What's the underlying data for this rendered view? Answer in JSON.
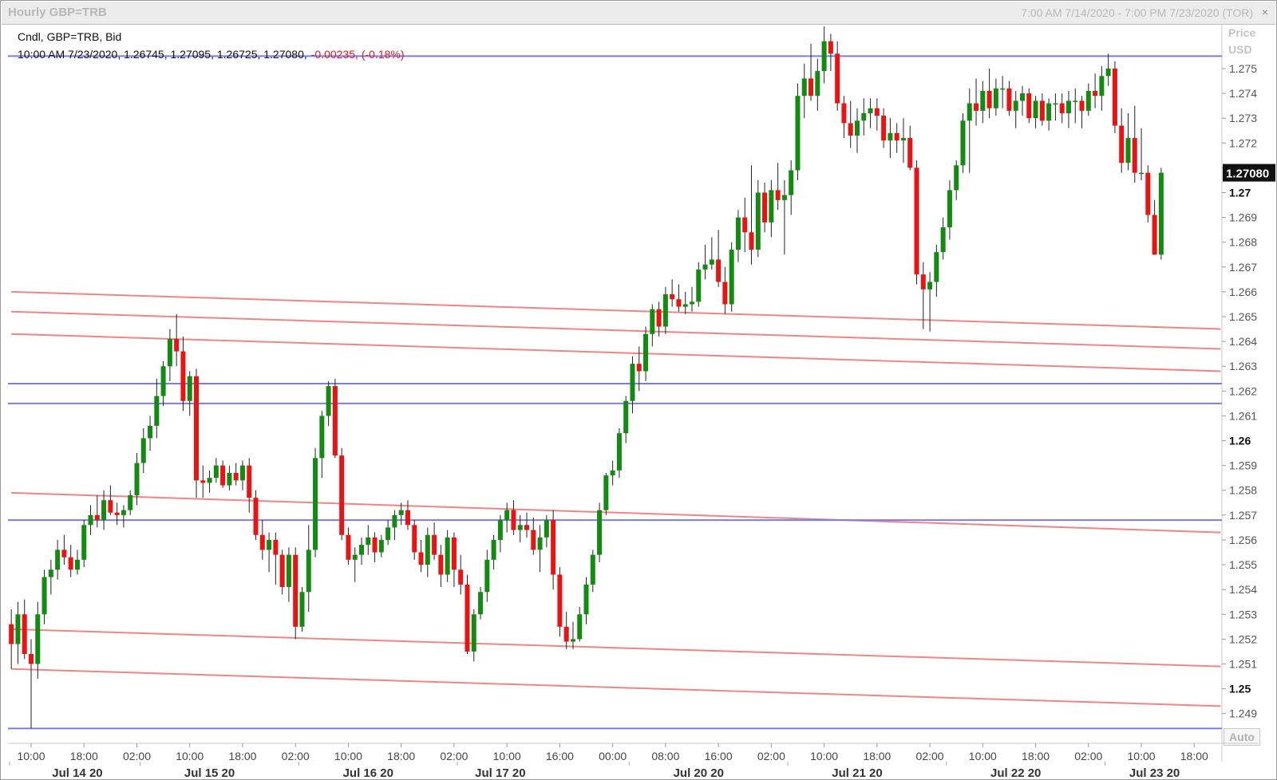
{
  "header": {
    "title": "Hourly GBP=TRB",
    "range": "7:00 AM 7/14/2020 - 7:00 PM 7/23/2020 (TOR)"
  },
  "legend": {
    "line1": "Cndl, GBP=TRB, Bid",
    "line2_prefix": "10:00 AM 7/23/2020, 1.26745, 1.27095, 1.26725, 1.27080,",
    "change": "-0.00235, (-0.18%)"
  },
  "axis": {
    "price_label": "Price",
    "unit_label": "USD",
    "auto_label": "Auto",
    "current_price": "1.27080",
    "up_color": "#118c11",
    "down_color": "#ee1111",
    "hline_color": "#7b7bf0",
    "trend_color": "#f07878"
  },
  "chart_data": {
    "type": "candlestick",
    "title": "Hourly GBP=TRB",
    "series_name": "GBP=TRB",
    "ylim": [
      1.2478,
      1.2768
    ],
    "y_ticks": [
      1.249,
      1.25,
      1.251,
      1.252,
      1.253,
      1.254,
      1.255,
      1.256,
      1.257,
      1.258,
      1.259,
      1.26,
      1.261,
      1.262,
      1.263,
      1.264,
      1.265,
      1.266,
      1.267,
      1.268,
      1.269,
      1.27,
      1.271,
      1.272,
      1.273,
      1.274,
      1.275
    ],
    "y_tick_labels": [
      "1.249",
      "1.25",
      "1.251",
      "1.252",
      "1.253",
      "1.254",
      "1.255",
      "1.256",
      "1.257",
      "1.258",
      "1.259",
      "1.26",
      "1.261",
      "1.262",
      "1.263",
      "1.264",
      "1.265",
      "1.266",
      "1.267",
      "1.268",
      "1.269",
      "1.27",
      "1.271",
      "1.272",
      "1.273",
      "1.274",
      "1.275"
    ],
    "x_tick_labels": [
      "10:00",
      "18:00",
      "02:00",
      "10:00",
      "18:00",
      "02:00",
      "10:00",
      "18:00",
      "02:00",
      "10:00",
      "16:00",
      "00:00",
      "08:00",
      "16:00",
      "02:00",
      "10:00",
      "18:00",
      "02:00",
      "10:00",
      "18:00",
      "02:00",
      "10:00",
      "18:00"
    ],
    "x_tick_index": [
      0,
      8,
      16,
      24,
      32,
      40,
      48,
      56,
      64,
      72,
      80,
      88,
      96,
      104,
      112,
      120,
      128,
      136,
      144,
      152,
      160,
      168,
      176
    ],
    "day_labels": [
      "Jul 14 20",
      "Jul 15 20",
      "Jul 16 20",
      "Jul 17 20",
      "Jul 20 20",
      "Jul 21 20",
      "Jul 22 20",
      "Jul 23 20"
    ],
    "day_label_index": [
      7,
      27,
      51,
      71,
      101,
      125,
      149,
      170
    ],
    "day_separator_index": [
      -3.5,
      16.5,
      40.5,
      64.5,
      90.5,
      114.5,
      138.5,
      162.5
    ],
    "horizontal_levels": [
      1.2755,
      1.2623,
      1.2615,
      1.2568,
      1.2484
    ],
    "trend_lines": [
      {
        "from": [
          -3,
          1.266
        ],
        "to": [
          180,
          1.2645
        ]
      },
      {
        "from": [
          -3,
          1.2652
        ],
        "to": [
          180,
          1.2637
        ]
      },
      {
        "from": [
          -3,
          1.2643
        ],
        "to": [
          180,
          1.2628
        ]
      },
      {
        "from": [
          -3,
          1.2579
        ],
        "to": [
          180,
          1.2563
        ]
      },
      {
        "from": [
          -3,
          1.2524
        ],
        "to": [
          180,
          1.2509
        ]
      },
      {
        "from": [
          -3,
          1.2508
        ],
        "to": [
          180,
          1.2493
        ]
      }
    ],
    "candles": [
      [
        -3,
        1.2526,
        1.2532,
        1.2508,
        1.2518
      ],
      [
        -2,
        1.2518,
        1.2535,
        1.251,
        1.253
      ],
      [
        -1,
        1.253,
        1.2536,
        1.2512,
        1.2514
      ],
      [
        0,
        1.2514,
        1.252,
        1.2484,
        1.251
      ],
      [
        1,
        1.251,
        1.2535,
        1.2504,
        1.253
      ],
      [
        2,
        1.253,
        1.2548,
        1.2526,
        1.2545
      ],
      [
        3,
        1.2545,
        1.2552,
        1.2538,
        1.2548
      ],
      [
        4,
        1.2548,
        1.256,
        1.2544,
        1.2556
      ],
      [
        5,
        1.2556,
        1.2562,
        1.255,
        1.2553
      ],
      [
        6,
        1.2553,
        1.2558,
        1.2545,
        1.2548
      ],
      [
        7,
        1.2548,
        1.2556,
        1.2546,
        1.2552
      ],
      [
        8,
        1.2552,
        1.2568,
        1.2549,
        1.2566
      ],
      [
        9,
        1.2566,
        1.2574,
        1.2562,
        1.257
      ],
      [
        10,
        1.257,
        1.2578,
        1.2565,
        1.2568
      ],
      [
        11,
        1.2568,
        1.258,
        1.2564,
        1.2576
      ],
      [
        12,
        1.2576,
        1.2582,
        1.257,
        1.2571
      ],
      [
        13,
        1.2571,
        1.2575,
        1.2566,
        1.257
      ],
      [
        14,
        1.257,
        1.2574,
        1.2565,
        1.2572
      ],
      [
        15,
        1.2572,
        1.258,
        1.257,
        1.2578
      ],
      [
        16,
        1.2578,
        1.2595,
        1.2574,
        1.2591
      ],
      [
        17,
        1.2591,
        1.2605,
        1.2587,
        1.2601
      ],
      [
        18,
        1.2601,
        1.261,
        1.2596,
        1.2606
      ],
      [
        19,
        1.2606,
        1.2625,
        1.2601,
        1.2618
      ],
      [
        20,
        1.2618,
        1.2632,
        1.2614,
        1.263
      ],
      [
        21,
        1.263,
        1.2645,
        1.2624,
        1.2641
      ],
      [
        22,
        1.2641,
        1.2651,
        1.263,
        1.2636
      ],
      [
        23,
        1.2636,
        1.2642,
        1.2612,
        1.2616
      ],
      [
        24,
        1.2616,
        1.2628,
        1.261,
        1.2626
      ],
      [
        25,
        1.2626,
        1.2629,
        1.2577,
        1.2584
      ],
      [
        26,
        1.2584,
        1.259,
        1.2577,
        1.2583
      ],
      [
        27,
        1.2583,
        1.2588,
        1.2579,
        1.2585
      ],
      [
        28,
        1.2585,
        1.2593,
        1.2583,
        1.259
      ],
      [
        29,
        1.259,
        1.2592,
        1.2581,
        1.2582
      ],
      [
        30,
        1.2582,
        1.259,
        1.258,
        1.2587
      ],
      [
        31,
        1.2587,
        1.2591,
        1.2582,
        1.2584
      ],
      [
        32,
        1.2584,
        1.2592,
        1.258,
        1.259
      ],
      [
        33,
        1.259,
        1.2593,
        1.2571,
        1.2577
      ],
      [
        34,
        1.2577,
        1.258,
        1.256,
        1.2562
      ],
      [
        35,
        1.2562,
        1.2568,
        1.2552,
        1.2556
      ],
      [
        36,
        1.2556,
        1.2563,
        1.2547,
        1.256
      ],
      [
        37,
        1.256,
        1.2563,
        1.2542,
        1.2554
      ],
      [
        38,
        1.2554,
        1.2556,
        1.2538,
        1.2541
      ],
      [
        39,
        1.2541,
        1.2557,
        1.2535,
        1.2554
      ],
      [
        40,
        1.2554,
        1.2557,
        1.252,
        1.2525
      ],
      [
        41,
        1.2525,
        1.2541,
        1.2523,
        1.2539
      ],
      [
        42,
        1.2539,
        1.2566,
        1.2531,
        1.2556
      ],
      [
        43,
        1.2556,
        1.2597,
        1.2553,
        1.2593
      ],
      [
        44,
        1.2593,
        1.2612,
        1.2585,
        1.261
      ],
      [
        45,
        1.261,
        1.2624,
        1.2606,
        1.2622
      ],
      [
        46,
        1.2622,
        1.2625,
        1.2593,
        1.2594
      ],
      [
        47,
        1.2594,
        1.2597,
        1.256,
        1.2562
      ],
      [
        48,
        1.2562,
        1.2565,
        1.255,
        1.2552
      ],
      [
        49,
        1.2552,
        1.2557,
        1.2543,
        1.2554
      ],
      [
        50,
        1.2554,
        1.2561,
        1.255,
        1.2558
      ],
      [
        51,
        1.2558,
        1.2566,
        1.2554,
        1.2561
      ],
      [
        52,
        1.2561,
        1.2563,
        1.2551,
        1.2555
      ],
      [
        53,
        1.2555,
        1.2562,
        1.2553,
        1.256
      ],
      [
        54,
        1.256,
        1.2568,
        1.2558,
        1.2565
      ],
      [
        55,
        1.2565,
        1.2572,
        1.256,
        1.257
      ],
      [
        56,
        1.257,
        1.2575,
        1.2566,
        1.2572
      ],
      [
        57,
        1.2572,
        1.2576,
        1.2564,
        1.2566
      ],
      [
        58,
        1.2566,
        1.2568,
        1.2552,
        1.2555
      ],
      [
        59,
        1.2555,
        1.256,
        1.2547,
        1.255
      ],
      [
        60,
        1.255,
        1.2565,
        1.2545,
        1.2562
      ],
      [
        61,
        1.2562,
        1.2567,
        1.2552,
        1.2554
      ],
      [
        62,
        1.2554,
        1.2558,
        1.2541,
        1.2546
      ],
      [
        63,
        1.2546,
        1.2564,
        1.2543,
        1.2561
      ],
      [
        64,
        1.2561,
        1.2563,
        1.2541,
        1.2548
      ],
      [
        65,
        1.2548,
        1.2554,
        1.2538,
        1.2542
      ],
      [
        66,
        1.2542,
        1.2546,
        1.2514,
        1.2515
      ],
      [
        67,
        1.2515,
        1.2532,
        1.2511,
        1.253
      ],
      [
        68,
        1.253,
        1.2541,
        1.2528,
        1.2539
      ],
      [
        69,
        1.2539,
        1.2556,
        1.2535,
        1.2552
      ],
      [
        70,
        1.2552,
        1.2562,
        1.2548,
        1.256
      ],
      [
        71,
        1.256,
        1.257,
        1.2555,
        1.2568
      ],
      [
        72,
        1.2568,
        1.2575,
        1.2563,
        1.2572
      ],
      [
        73,
        1.2572,
        1.2576,
        1.2562,
        1.2564
      ],
      [
        74,
        1.2564,
        1.257,
        1.2559,
        1.2566
      ],
      [
        75,
        1.2566,
        1.2571,
        1.2561,
        1.2564
      ],
      [
        76,
        1.2564,
        1.2569,
        1.2554,
        1.2556
      ],
      [
        77,
        1.2556,
        1.2566,
        1.2547,
        1.2561
      ],
      [
        78,
        1.2561,
        1.257,
        1.2557,
        1.2568
      ],
      [
        79,
        1.2568,
        1.2572,
        1.254,
        1.2546
      ],
      [
        80,
        1.2546,
        1.2549,
        1.2521,
        1.2525
      ],
      [
        81,
        1.2525,
        1.2531,
        1.2516,
        1.2519
      ],
      [
        82,
        1.2519,
        1.2527,
        1.2516,
        1.252
      ],
      [
        83,
        1.252,
        1.2533,
        1.2519,
        1.253
      ],
      [
        84,
        1.253,
        1.2545,
        1.2526,
        1.2542
      ],
      [
        85,
        1.2542,
        1.2556,
        1.2539,
        1.2554
      ],
      [
        86,
        1.2554,
        1.2575,
        1.2551,
        1.2572
      ],
      [
        87,
        1.2572,
        1.2587,
        1.257,
        1.2586
      ],
      [
        88,
        1.2586,
        1.2592,
        1.2582,
        1.2588
      ],
      [
        89,
        1.2588,
        1.2605,
        1.2585,
        1.2603
      ],
      [
        90,
        1.2603,
        1.2618,
        1.2599,
        1.2616
      ],
      [
        91,
        1.2616,
        1.2634,
        1.2611,
        1.2631
      ],
      [
        92,
        1.2631,
        1.2638,
        1.262,
        1.2628
      ],
      [
        93,
        1.2628,
        1.2646,
        1.2624,
        1.2643
      ],
      [
        94,
        1.2643,
        1.2655,
        1.2638,
        1.2653
      ],
      [
        95,
        1.2653,
        1.2656,
        1.2642,
        1.2646
      ],
      [
        96,
        1.2646,
        1.2662,
        1.2643,
        1.2659
      ],
      [
        97,
        1.2659,
        1.2665,
        1.2654,
        1.2657
      ],
      [
        98,
        1.2657,
        1.2663,
        1.2652,
        1.2654
      ],
      [
        99,
        1.2654,
        1.266,
        1.2651,
        1.2655
      ],
      [
        100,
        1.2655,
        1.2662,
        1.2652,
        1.2656
      ],
      [
        101,
        1.2656,
        1.2672,
        1.2654,
        1.2669
      ],
      [
        102,
        1.2669,
        1.2679,
        1.2665,
        1.2671
      ],
      [
        103,
        1.2671,
        1.2682,
        1.2669,
        1.2673
      ],
      [
        104,
        1.2673,
        1.2685,
        1.2662,
        1.2664
      ],
      [
        105,
        1.2664,
        1.267,
        1.2651,
        1.2655
      ],
      [
        106,
        1.2655,
        1.268,
        1.2652,
        1.2677
      ],
      [
        107,
        1.2677,
        1.2693,
        1.2672,
        1.269
      ],
      [
        108,
        1.269,
        1.2698,
        1.2676,
        1.2684
      ],
      [
        109,
        1.2684,
        1.2711,
        1.2671,
        1.2677
      ],
      [
        110,
        1.2677,
        1.2705,
        1.2674,
        1.27
      ],
      [
        111,
        1.27,
        1.2704,
        1.2684,
        1.2688
      ],
      [
        112,
        1.2688,
        1.2705,
        1.2682,
        1.2701
      ],
      [
        113,
        1.2701,
        1.2712,
        1.2693,
        1.2697
      ],
      [
        114,
        1.2697,
        1.2705,
        1.2675,
        1.2699
      ],
      [
        115,
        1.2699,
        1.2713,
        1.2691,
        1.2709
      ],
      [
        116,
        1.2709,
        1.2744,
        1.2705,
        1.2739
      ],
      [
        117,
        1.2739,
        1.2752,
        1.273,
        1.2746
      ],
      [
        118,
        1.2746,
        1.276,
        1.2737,
        1.2739
      ],
      [
        119,
        1.2739,
        1.2754,
        1.2733,
        1.2749
      ],
      [
        120,
        1.2749,
        1.2767,
        1.2744,
        1.2761
      ],
      [
        121,
        1.2761,
        1.2764,
        1.2749,
        1.2756
      ],
      [
        122,
        1.2756,
        1.2761,
        1.2733,
        1.2736
      ],
      [
        123,
        1.2736,
        1.2739,
        1.2722,
        1.2728
      ],
      [
        124,
        1.2728,
        1.2737,
        1.2718,
        1.2723
      ],
      [
        125,
        1.2723,
        1.2734,
        1.2716,
        1.2729
      ],
      [
        126,
        1.2729,
        1.2738,
        1.2723,
        1.2732
      ],
      [
        127,
        1.2732,
        1.2738,
        1.2726,
        1.2734
      ],
      [
        128,
        1.2734,
        1.2738,
        1.2725,
        1.2731
      ],
      [
        129,
        1.2731,
        1.2734,
        1.2718,
        1.2721
      ],
      [
        130,
        1.2721,
        1.273,
        1.2714,
        1.2724
      ],
      [
        131,
        1.2724,
        1.2728,
        1.2716,
        1.2721
      ],
      [
        132,
        1.2721,
        1.273,
        1.2712,
        1.2722
      ],
      [
        133,
        1.2722,
        1.2727,
        1.2709,
        1.271
      ],
      [
        134,
        1.271,
        1.2713,
        1.2663,
        1.2667
      ],
      [
        135,
        1.2667,
        1.2672,
        1.2645,
        1.2661
      ],
      [
        136,
        1.2661,
        1.2668,
        1.2644,
        1.2664
      ],
      [
        137,
        1.2664,
        1.2679,
        1.2658,
        1.2676
      ],
      [
        138,
        1.2676,
        1.269,
        1.2673,
        1.2686
      ],
      [
        139,
        1.2686,
        1.2705,
        1.2681,
        1.2701
      ],
      [
        140,
        1.2701,
        1.2713,
        1.2697,
        1.2711
      ],
      [
        141,
        1.2711,
        1.2732,
        1.2708,
        1.2729
      ],
      [
        142,
        1.2729,
        1.2742,
        1.2708,
        1.2736
      ],
      [
        143,
        1.2736,
        1.2746,
        1.2727,
        1.2733
      ],
      [
        144,
        1.2733,
        1.2745,
        1.2728,
        1.2741
      ],
      [
        145,
        1.2741,
        1.275,
        1.273,
        1.2734
      ],
      [
        146,
        1.2734,
        1.2746,
        1.2731,
        1.2742
      ],
      [
        147,
        1.2742,
        1.2747,
        1.2734,
        1.2742
      ],
      [
        148,
        1.2742,
        1.2745,
        1.2731,
        1.2733
      ],
      [
        149,
        1.2733,
        1.2741,
        1.2726,
        1.2737
      ],
      [
        150,
        1.2737,
        1.2743,
        1.2731,
        1.274
      ],
      [
        151,
        1.274,
        1.2742,
        1.2728,
        1.273
      ],
      [
        152,
        1.273,
        1.2739,
        1.2726,
        1.2737
      ],
      [
        153,
        1.2737,
        1.274,
        1.2727,
        1.2729
      ],
      [
        154,
        1.2729,
        1.2738,
        1.2725,
        1.2736
      ],
      [
        155,
        1.2736,
        1.274,
        1.2729,
        1.2736
      ],
      [
        156,
        1.2736,
        1.274,
        1.2728,
        1.2732
      ],
      [
        157,
        1.2732,
        1.2741,
        1.2726,
        1.2737
      ],
      [
        158,
        1.2737,
        1.2742,
        1.2728,
        1.2737
      ],
      [
        159,
        1.2737,
        1.2739,
        1.2726,
        1.2733
      ],
      [
        160,
        1.2733,
        1.2744,
        1.2731,
        1.2741
      ],
      [
        161,
        1.2741,
        1.2748,
        1.2734,
        1.2739
      ],
      [
        162,
        1.2739,
        1.2751,
        1.2733,
        1.2747
      ],
      [
        163,
        1.2747,
        1.2756,
        1.2743,
        1.275
      ],
      [
        164,
        1.275,
        1.2753,
        1.2724,
        1.2727
      ],
      [
        165,
        1.2727,
        1.2734,
        1.2708,
        1.2712
      ],
      [
        166,
        1.2712,
        1.2732,
        1.2709,
        1.2722
      ],
      [
        167,
        1.2722,
        1.2735,
        1.2704,
        1.2708
      ],
      [
        168,
        1.2708,
        1.2726,
        1.2705,
        1.2708
      ],
      [
        169,
        1.2708,
        1.2711,
        1.2688,
        1.2691
      ],
      [
        170,
        1.2691,
        1.2697,
        1.2675,
        1.2675
      ],
      [
        171,
        1.2675,
        1.271,
        1.2673,
        1.2708
      ]
    ]
  }
}
